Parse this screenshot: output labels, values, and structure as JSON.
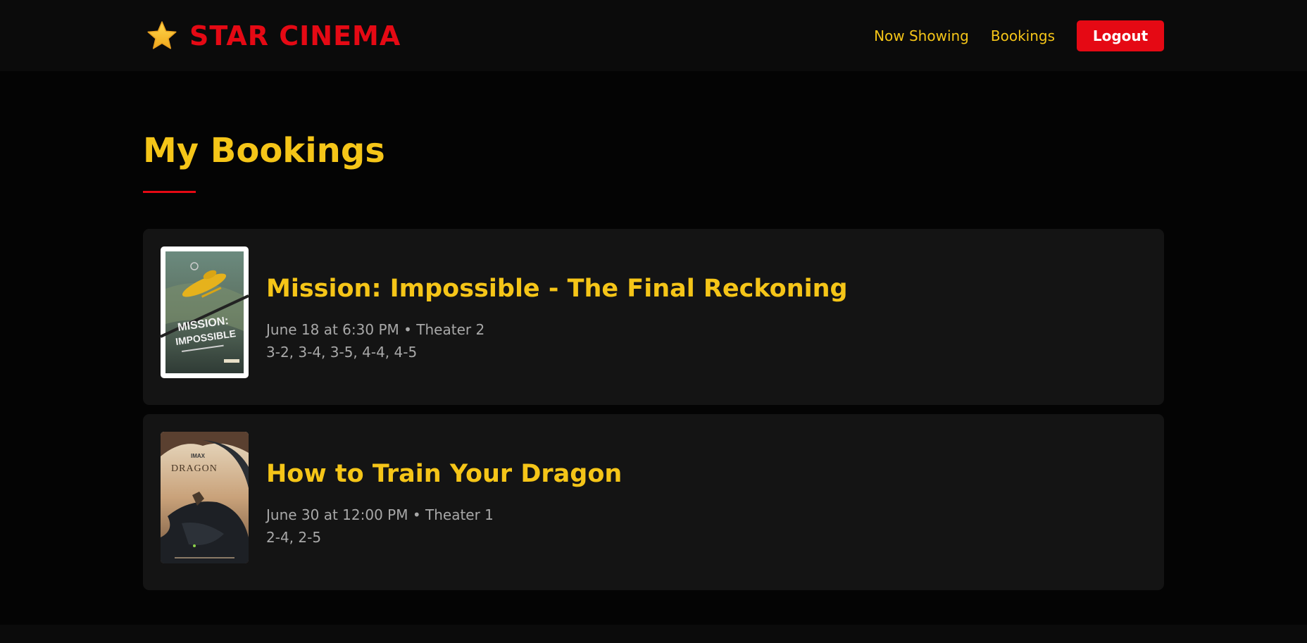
{
  "header": {
    "brand": "STAR CINEMA",
    "logo_icon": "star-icon",
    "nav": {
      "now_showing": "Now Showing",
      "bookings": "Bookings",
      "logout": "Logout"
    }
  },
  "main": {
    "title": "My Bookings",
    "bookings": [
      {
        "movie": "Mission: Impossible - The Final Reckoning",
        "showtime": "June 18 at 6:30 PM • Theater 2",
        "seats": "3-2, 3-4, 3-5, 4-4, 4-5",
        "poster_text": "MISSION: IMPOSSIBLE"
      },
      {
        "movie": "How to Train Your Dragon",
        "showtime": "June 30 at 12:00 PM • Theater 1",
        "seats": "2-4, 2-5",
        "poster_text": "DRAGON",
        "poster_badge": "IMAX"
      }
    ]
  },
  "colors": {
    "accent_red": "#e50914",
    "accent_gold": "#f5c518",
    "background": "#040404",
    "card": "#141414"
  }
}
